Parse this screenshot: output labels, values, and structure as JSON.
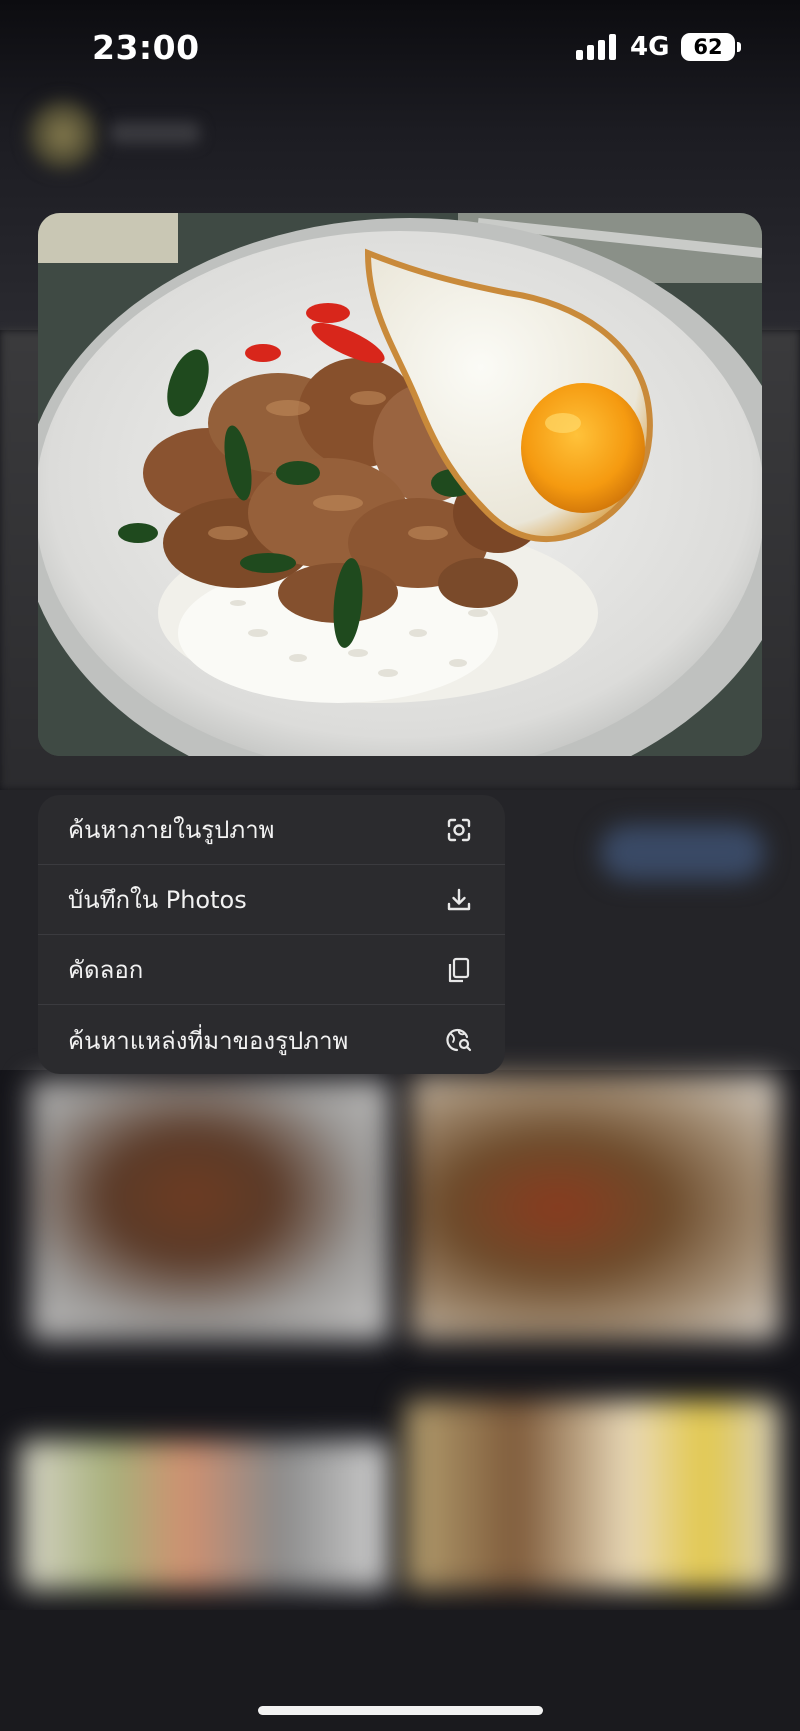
{
  "status_bar": {
    "time": "23:00",
    "network": "4G",
    "battery": "62",
    "icons": [
      "signal-bars-icon",
      "battery-icon"
    ]
  },
  "preview": {
    "icon": "photo-fried-rice-basil-pork-egg"
  },
  "context_menu": {
    "items": [
      {
        "label": "ค้นหาภายในรูปภาพ",
        "icon": "visual-search-scan-icon"
      },
      {
        "label": "บันทึกใน Photos",
        "icon": "download-icon"
      },
      {
        "label": "คัดลอก",
        "icon": "copy-icon"
      },
      {
        "label": "ค้นหาแหล่งที่มาของรูปภาพ",
        "icon": "reverse-image-search-icon"
      }
    ]
  },
  "colors": {
    "menu_background": "#2b2b2e",
    "menu_text": "#f2f2f2",
    "background": "#15151a"
  }
}
